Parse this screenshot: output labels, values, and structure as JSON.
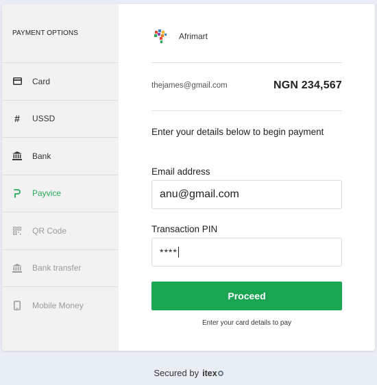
{
  "sidebar": {
    "title": "PAYMENT OPTIONS",
    "items": [
      {
        "label": "Card",
        "icon": "credit-card-icon",
        "state": "enabled"
      },
      {
        "label": "USSD",
        "icon": "hash-icon",
        "state": "enabled"
      },
      {
        "label": "Bank",
        "icon": "bank-icon",
        "state": "enabled"
      },
      {
        "label": "Payvice",
        "icon": "payvice-icon",
        "state": "active"
      },
      {
        "label": "QR Code",
        "icon": "qr-code-icon",
        "state": "disabled"
      },
      {
        "label": "Bank transfer",
        "icon": "bank-icon",
        "state": "disabled"
      },
      {
        "label": "Mobile Money",
        "icon": "mobile-phone-icon",
        "state": "disabled"
      }
    ]
  },
  "merchant": {
    "name": "Afrimart",
    "logo_icon": "africa-map-logo-icon"
  },
  "customer": {
    "email": "thejames@gmail.com"
  },
  "amount": "NGN 234,567",
  "form": {
    "instructions": "Enter your details below to begin payment",
    "email_label": "Email address",
    "email_value": "anu@gmail.com",
    "pin_label": "Transaction PIN",
    "pin_value": "****",
    "proceed_label": "Proceed",
    "hint": "Enter your card details to pay"
  },
  "footer": {
    "secured_by": "Secured by",
    "brand": "itex"
  },
  "colors": {
    "accent": "#1aa553",
    "active_text": "#27a95a",
    "disabled_text": "#9a9a9a",
    "page_bg": "#e9eef4"
  }
}
